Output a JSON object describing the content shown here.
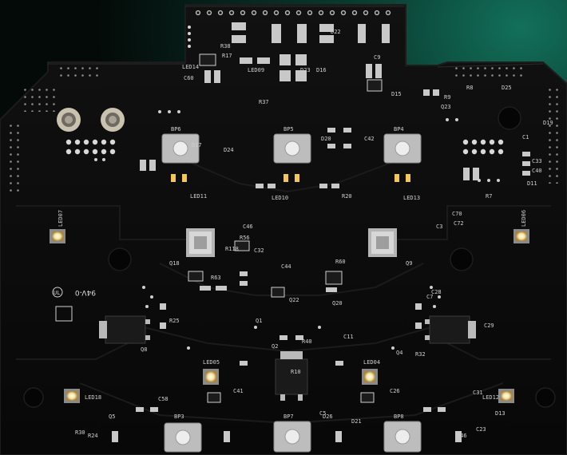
{
  "scene": {
    "subject": "printed-circuit-board",
    "palette": {
      "background_top_right": "#0d5a4a",
      "background_dark": "#06120f",
      "board": "#0b0b0b",
      "silkscreen": "#d8d8d8",
      "pad_gold": "#c9a25a",
      "led_white": "#f6f0d6",
      "led_warm": "#f3c65a",
      "button_cap": "#cfcfcf"
    }
  },
  "silkscreen": {
    "button_labels": [
      "BP6",
      "BP5",
      "BP4",
      "BP3",
      "BP7",
      "BP8"
    ],
    "led_labels": [
      "LED07",
      "LED06",
      "LED05",
      "LED04",
      "LED18",
      "LED11",
      "LED10",
      "LED13",
      "LED09",
      "LED12",
      "LED14"
    ],
    "ic_labels": [
      "Q18",
      "Q20",
      "Q1",
      "Q2",
      "Q5",
      "Q4",
      "Q8",
      "Q9",
      "Q22",
      "Q23"
    ],
    "passive_labels": [
      "R38",
      "R37",
      "R56",
      "R63",
      "R118",
      "R60",
      "R20",
      "R25",
      "R40",
      "R32",
      "R24",
      "R30",
      "R46",
      "R17",
      "R7",
      "R9",
      "R10",
      "R8",
      "C1",
      "C3",
      "C5",
      "C7",
      "C9",
      "C11",
      "C23",
      "C26",
      "C28",
      "C29",
      "C31",
      "C32",
      "C33",
      "C40",
      "C41",
      "C42",
      "C44",
      "C46",
      "C58",
      "C60",
      "C70",
      "C72",
      "D11",
      "D13",
      "D15",
      "D16",
      "D17",
      "D19",
      "D20",
      "D21",
      "D22",
      "D23",
      "D24",
      "D25",
      "D26"
    ],
    "marking": "94V-0",
    "logo_mark": "UL"
  }
}
